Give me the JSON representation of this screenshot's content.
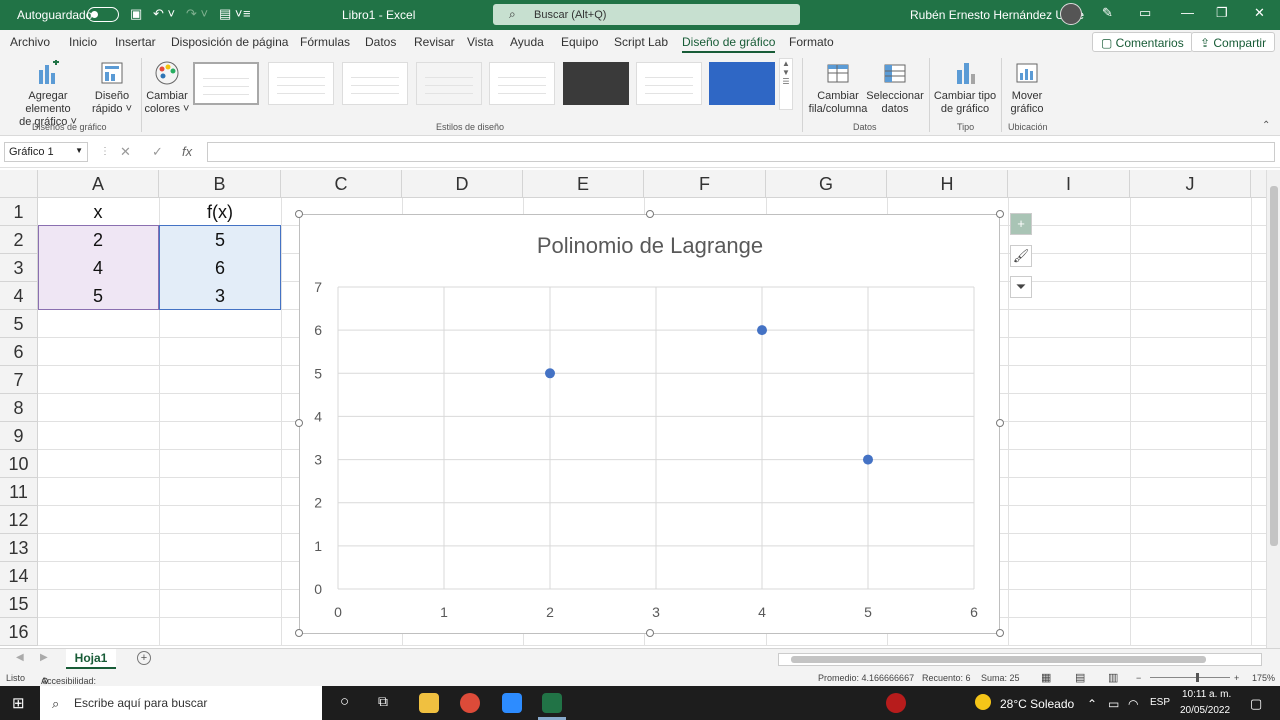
{
  "titlebar": {
    "autosave_label": "Autoguardado",
    "doc_title": "Libro1  -  Excel",
    "search_placeholder": "Buscar (Alt+Q)",
    "user_name": "Rubén Ernesto Hernández Uribe"
  },
  "menu": {
    "tabs": [
      "Archivo",
      "Inicio",
      "Insertar",
      "Disposición de página",
      "Fórmulas",
      "Datos",
      "Revisar",
      "Vista",
      "Ayuda",
      "Equipo",
      "Script Lab",
      "Diseño de gráfico",
      "Formato"
    ],
    "active_tab": "Diseño de gráfico",
    "comments": "Comentarios",
    "share": "Compartir"
  },
  "ribbon": {
    "add_element_1": "Agregar elemento",
    "add_element_2": "de gráfico ˅",
    "quick_layout_1": "Diseño",
    "quick_layout_2": "rápido ˅",
    "change_colors_1": "Cambiar",
    "change_colors_2": "colores ˅",
    "group_chart_layouts": "Diseños de gráfico",
    "group_chart_styles": "Estilos de diseño",
    "switch_row_col_1": "Cambiar",
    "switch_row_col_2": "fila/columna",
    "select_data_1": "Seleccionar",
    "select_data_2": "datos",
    "group_data": "Datos",
    "change_type_1": "Cambiar tipo",
    "change_type_2": "de gráfico",
    "group_type": "Tipo",
    "move_chart_1": "Mover",
    "move_chart_2": "gráfico",
    "group_location": "Ubicación"
  },
  "formula_bar": {
    "name_box": "Gráfico 1",
    "fx": "fx",
    "value": ""
  },
  "sheet": {
    "columns": [
      "A",
      "B",
      "C",
      "D",
      "E",
      "F",
      "G",
      "H",
      "I",
      "J"
    ],
    "rows": [
      "1",
      "2",
      "3",
      "4",
      "5",
      "6",
      "7",
      "8",
      "9",
      "10",
      "11",
      "12",
      "13",
      "14",
      "15",
      "16"
    ],
    "cells": {
      "A1": "x",
      "B1": "f(x)",
      "A2": "2",
      "B2": "5",
      "A3": "4",
      "B3": "6",
      "A4": "5",
      "B4": "3"
    }
  },
  "chart_data": {
    "type": "scatter",
    "title": "Polinomio de Lagrange",
    "x": [
      2,
      4,
      5
    ],
    "y": [
      5,
      6,
      3
    ],
    "xlim": [
      0,
      6
    ],
    "ylim": [
      0,
      7
    ],
    "xticks": [
      0,
      1,
      2,
      3,
      4,
      5,
      6
    ],
    "yticks": [
      0,
      1,
      2,
      3,
      4,
      5,
      6,
      7
    ],
    "grid": true,
    "marker_color": "#4472c4"
  },
  "sheet_tabs": {
    "active": "Hoja1",
    "add": "+"
  },
  "status": {
    "ready": "Listo",
    "accessibility": "Accesibilidad: es necesario investigar",
    "average": "Promedio: 4.166666667",
    "count": "Recuento: 6",
    "sum": "Suma: 25",
    "zoom": "175%"
  },
  "taskbar": {
    "search": "Escribe aquí para buscar",
    "weather": "28°C  Soleado",
    "lang": "ESP",
    "time": "10:11 a. m.",
    "date": "20/05/2022"
  }
}
